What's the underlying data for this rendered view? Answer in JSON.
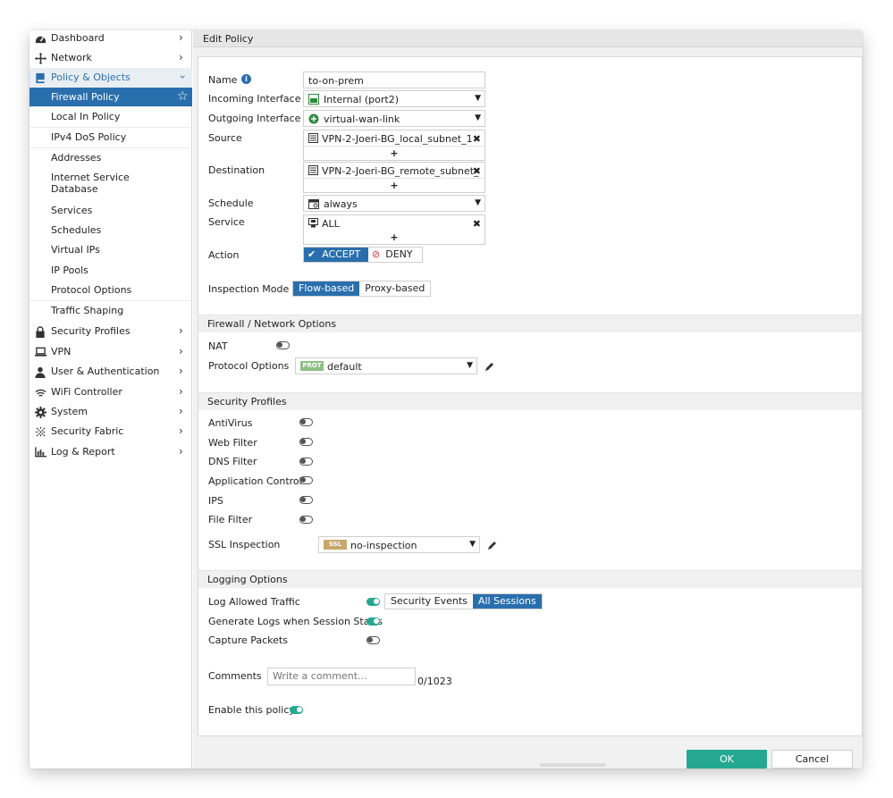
{
  "sidebar": {
    "dashboard": "Dashboard",
    "network": "Network",
    "policy_objects": "Policy & Objects",
    "sub_items": [
      "Firewall Policy",
      "Local In Policy",
      "IPv4 DoS Policy",
      "Addresses",
      "Internet Service Database",
      "Services",
      "Schedules",
      "Virtual IPs",
      "IP Pools",
      "Protocol Options",
      "Traffic Shaping"
    ],
    "security_profiles": "Security Profiles",
    "vpn": "VPN",
    "user_auth": "User & Authentication",
    "wifi": "WiFi Controller",
    "system": "System",
    "security_fabric": "Security Fabric",
    "log_report": "Log & Report"
  },
  "header": {
    "title": "Edit Policy"
  },
  "form": {
    "name_label": "Name",
    "name_value": "to-on-prem",
    "incoming_label": "Incoming Interface",
    "incoming_value": "Internal (port2)",
    "outgoing_label": "Outgoing Interface",
    "outgoing_value": "virtual-wan-link",
    "source_label": "Source",
    "source_value": "VPN-2-Joeri-BG_local_subnet_1",
    "destination_label": "Destination",
    "destination_value": "VPN-2-Joeri-BG_remote_subnet_",
    "schedule_label": "Schedule",
    "schedule_value": "always",
    "service_label": "Service",
    "service_value": "ALL",
    "plus": "+",
    "action_label": "Action",
    "action_accept": "ACCEPT",
    "action_deny": "DENY",
    "inspection_label": "Inspection Mode",
    "inspection_flow": "Flow-based",
    "inspection_proxy": "Proxy-based"
  },
  "firewall_options": {
    "title": "Firewall / Network Options",
    "nat_label": "NAT",
    "protocol_label": "Protocol Options",
    "protocol_badge": "PROT",
    "protocol_value": "default"
  },
  "security_profiles": {
    "title": "Security Profiles",
    "items": [
      "AntiVirus",
      "Web Filter",
      "DNS Filter",
      "Application Control",
      "IPS",
      "File Filter"
    ],
    "ssl_label": "SSL Inspection",
    "ssl_badge": "SSL",
    "ssl_value": "no-inspection"
  },
  "logging": {
    "title": "Logging Options",
    "log_allowed_label": "Log Allowed Traffic",
    "security_events": "Security Events",
    "all_sessions": "All Sessions",
    "generate_logs_label": "Generate Logs when Session Starts",
    "capture_label": "Capture Packets"
  },
  "comments": {
    "label": "Comments",
    "placeholder": "Write a comment...",
    "counter": "0/1023"
  },
  "enable": {
    "label": "Enable this policy"
  },
  "buttons": {
    "ok": "OK",
    "cancel": "Cancel"
  },
  "colors": {
    "accent": "#2a6fad",
    "toggle_on": "#25a891",
    "ok_button": "#25a891"
  }
}
